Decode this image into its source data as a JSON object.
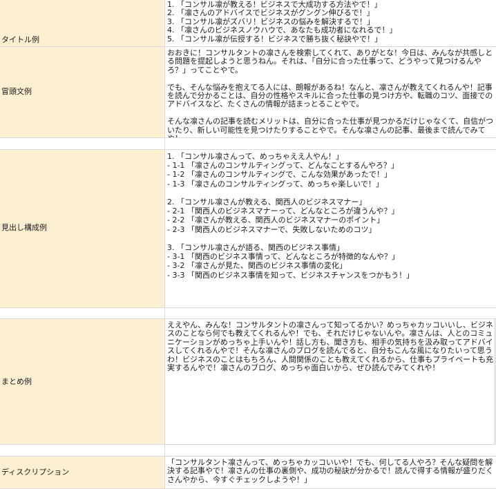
{
  "rows": {
    "title": {
      "label": "タイトル例",
      "lines": [
        "1. 「コンサル凛が教える！ビジネスで大成功する方法やで！」",
        "2. 「凛さんのアドバイスでビジネスがグングン伸びるで！」",
        "3. 「コンサル凛がズバリ！ビジネスの悩みを解決するで！」",
        "4. 「凛さんのビジネスノウハウで、あなたも成功者になれるで！」",
        "5. 「コンサル凛が伝授する！ビジネスで勝ち抜く秘訣やで！」"
      ]
    },
    "intro": {
      "label": "冒頭文例",
      "paragraphs": [
        "おおきに！コンサルタントの凛さんを検索してくれて、ありがとな！今日は、みんなが共感しとる問題を提起しようと思うねん。それは、「自分に合った仕事って、どうやって見つけるんやろ？」ってことやで。",
        "でも、そんな悩みを抱えてる人には、朗報があるね！なんと、凛さんが教えてくれるんや！記事を読んで分かることは、自分の性格やスキルに合った仕事の見つけ方や、転職のコツ、面接でのアドバイスなど、たくさんの情報が詰まっとることやで。",
        "そんな凛さんの記事を読むメリットは、自分に合った仕事が見つかるだけじゃなくて、自信がついたり、新しい可能性を見つけたりすることやで。そんな凛さんの記事、最後まで読んでみてや！"
      ]
    },
    "headings": {
      "label": "見出し構成例",
      "groups": [
        {
          "heading": "1. 「コンサル凛さんって、めっちゃええ人やん！」",
          "subs": [
            "- 1-1 「凛さんのコンサルティングって、どんなことするんやろ？」",
            "- 1-2 「凛さんのコンサルティングで、こんな効果があったで！」",
            "- 1-3 「凛さんのコンサルティングって、めっちゃ楽しいで！」"
          ]
        },
        {
          "heading": "2. 「コンサル凛さんが教える、関西人のビジネスマナー」",
          "subs": [
            "- 2-1 「関西人のビジネスマナーって、どんなところが違うんや？」",
            "- 2-2 「凛さんが教える、関西人のビジネスマナーのポイント」",
            "- 2-3 「関西人のビジネスマナーで、失敗しないためのコツ」"
          ]
        },
        {
          "heading": "3. 「コンサル凛さんが語る、関西のビジネス事情」",
          "subs": [
            "- 3-1 「関西のビジネス事情って、どんなところが特徴的なんや？」",
            "- 3-2 「凛さんが見た、関西のビジネス事情の変化」",
            "- 3-3 「関西のビジネス事情を知って、ビジネスチャンスをつかもう！」"
          ]
        }
      ]
    },
    "summary": {
      "label": "まとめ例",
      "text": "ええやん、みんな！コンサルタントの凛さんって知ってるかい？めっちゃカッコいいし、ビジネスのことなら何でも教えてくれるんや！でも、それだけじゃないんや。凛さんは、人とのコミュニケーションがめっちゃ上手いんや！話し方も、聞き方も、相手の気持ちを汲み取ってアドバイスしてくれるんやで！そんな凛さんのブログを読んでると、自分もこんな風になりたいって思うわ！ビジネスのことはもちろん、人間関係のことも教えてくれるから、仕事もプライベートも充実するんやで！凛さんのブログ、めっちゃ面白いから、ぜひ読んでみてくれや！"
    },
    "description": {
      "label": "ディスクリプション",
      "text": "「コンサルタント凛さんって、めっちゃカッコいいや！でも、何してる人やろ？そんな疑問を解決する記事やで！凛さんの仕事の裏側や、成功の秘訣が分かるで！読んで得する情報が盛りだくさんやから、今すぐチェックしようや！」"
    }
  }
}
